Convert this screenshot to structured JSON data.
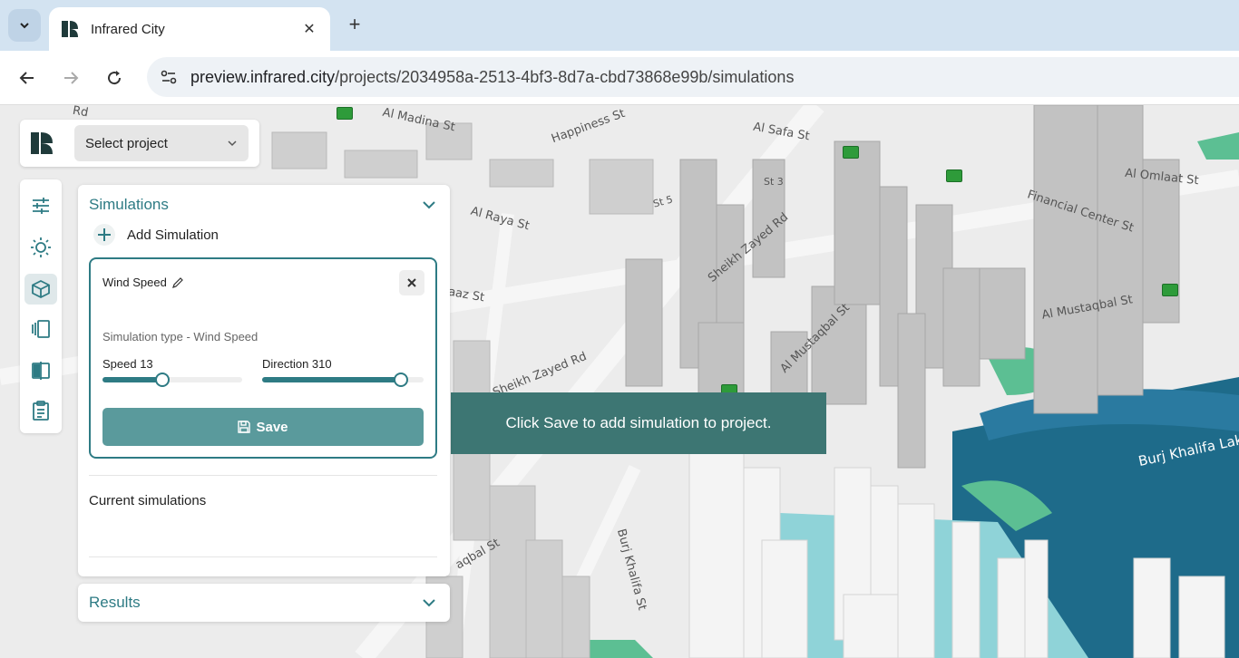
{
  "browser": {
    "tab_title": "Infrared City",
    "url_host": "preview.infrared.city",
    "url_path": "/projects/2034958a-2513-4bf3-8d7a-cbd73868e99b/simulations"
  },
  "map": {
    "street_labels": [
      "Al Madina St",
      "Happiness St",
      "Al Safa St",
      "Al Omlaat St",
      "Financial Center St",
      "Sheikh Zayed Rd",
      "Al Raya St",
      "Al Mustaqbal St",
      "Sheikh Zayed Rd",
      "Burj Khalifa Lak",
      "Burj Khalifa St",
      "aqbal St",
      "aaz St",
      "Al Mustaqbal St",
      "St 5",
      "St 3",
      "Rd"
    ],
    "accent_colors": {
      "water_dark": "#1e6b8a",
      "water_light": "#8fd3d8",
      "park": "#5cbf93",
      "buildings": "#c9c9c9"
    }
  },
  "toast": {
    "message": "Click Save to add simulation to project."
  },
  "project_selector": {
    "placeholder": "Select project"
  },
  "rail": {
    "icons": [
      "sliders-icon",
      "sun-icon",
      "cube-icon",
      "panels-icon",
      "compare-icon",
      "clipboard-icon"
    ]
  },
  "simulations": {
    "title": "Simulations",
    "add_label": "Add Simulation",
    "card": {
      "name": "Wind Speed",
      "type_text": "Simulation type - Wind Speed",
      "speed_label": "Speed 13",
      "speed_fraction": 0.43,
      "direction_label": "Direction 310",
      "direction_fraction": 0.86,
      "save_label": "Save"
    },
    "current_label": "Current simulations"
  },
  "results": {
    "title": "Results"
  }
}
